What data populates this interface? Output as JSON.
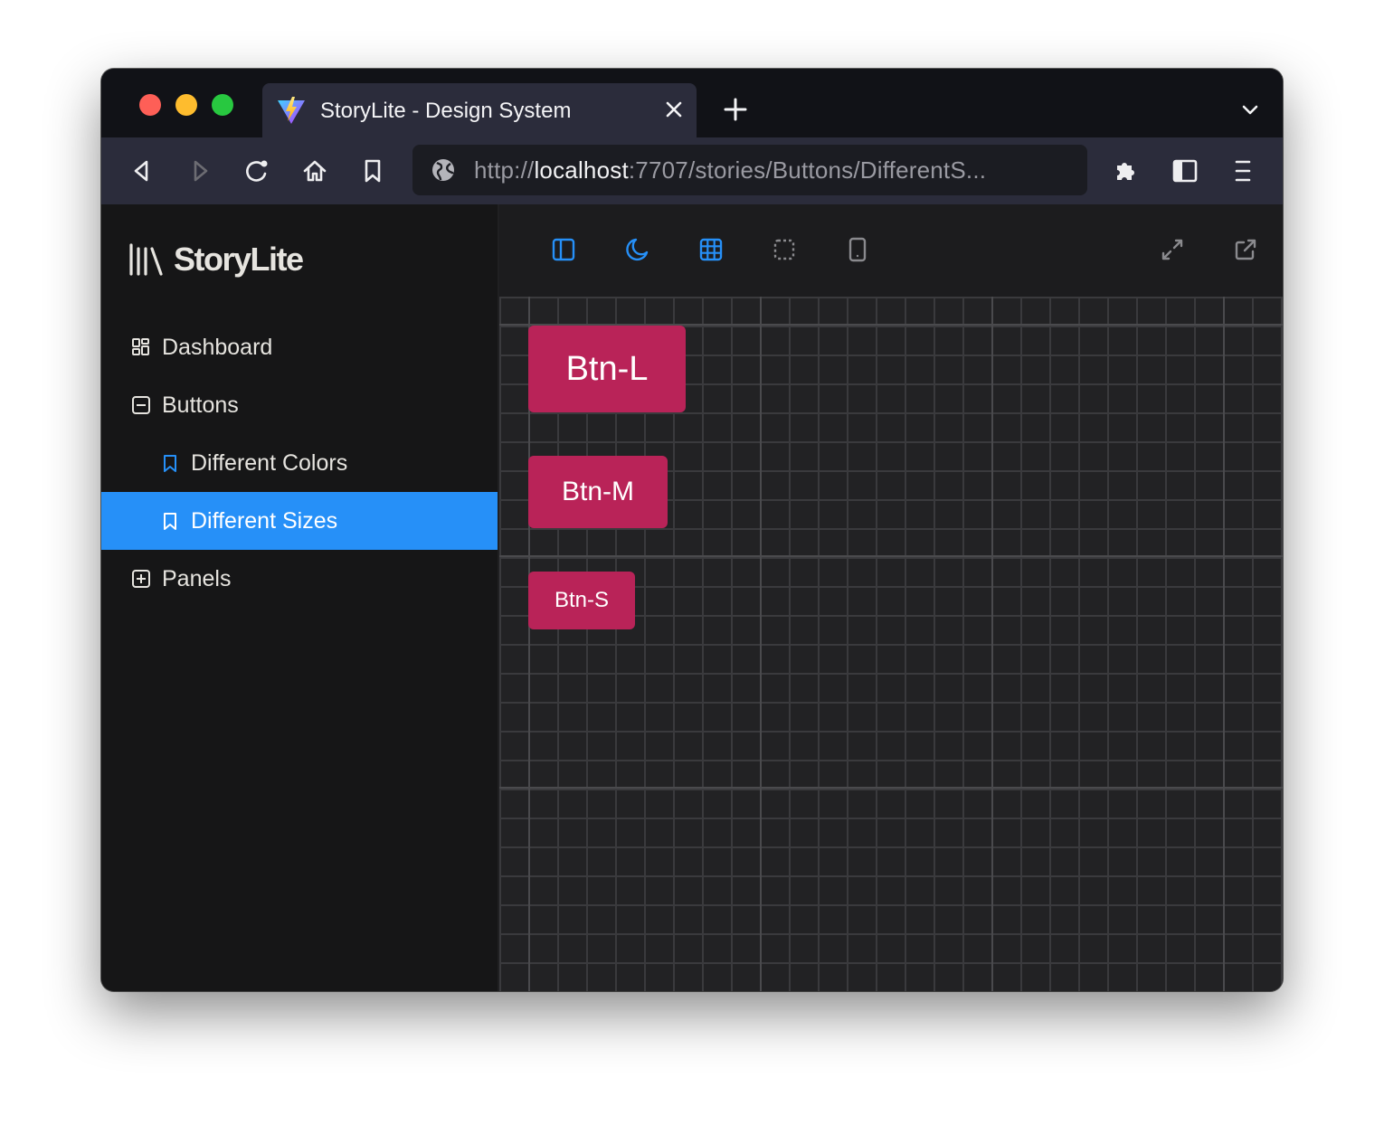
{
  "browser": {
    "tab": {
      "title": "StoryLite - Design System",
      "favicon": "vite-logo-icon"
    },
    "url": {
      "scheme": "http://",
      "host": "localhost",
      "rest": ":7707/stories/Buttons/DifferentS..."
    },
    "nav_icons": [
      "back-icon",
      "forward-icon",
      "reload-icon",
      "home-icon",
      "bookmark-icon"
    ],
    "right_icons": [
      "extensions-icon",
      "sidebar-toggle-icon",
      "menu-icon"
    ]
  },
  "app": {
    "logo_text": "StoryLite",
    "sidebar": {
      "items": [
        {
          "label": "Dashboard",
          "icon": "dashboard-icon",
          "level": 0,
          "active": false
        },
        {
          "label": "Buttons",
          "icon": "collapse-icon",
          "level": 0,
          "active": false,
          "expanded": true
        },
        {
          "label": "Different Colors",
          "icon": "bookmark-icon",
          "level": 1,
          "active": false
        },
        {
          "label": "Different Sizes",
          "icon": "bookmark-icon",
          "level": 1,
          "active": true
        },
        {
          "label": "Panels",
          "icon": "expand-icon",
          "level": 0,
          "active": false,
          "expanded": false
        }
      ]
    },
    "toolbar": {
      "tools": [
        {
          "name": "sidebar-toggle",
          "active": true
        },
        {
          "name": "dark-mode",
          "active": true
        },
        {
          "name": "grid",
          "active": true
        },
        {
          "name": "outline",
          "active": false
        },
        {
          "name": "mobile-viewport",
          "active": false
        }
      ],
      "right_tools": [
        "fullscreen",
        "open-new-window"
      ]
    },
    "canvas": {
      "buttons": [
        {
          "label": "Btn-L",
          "size": "large"
        },
        {
          "label": "Btn-M",
          "size": "medium"
        },
        {
          "label": "Btn-S",
          "size": "small"
        }
      ]
    }
  },
  "colors": {
    "accent": "#2690f8",
    "button": "#b92358",
    "sidebar_bg": "#161617",
    "canvas_bg": "#222224",
    "chrome_bg": "#2b2c3b",
    "tabstrip_bg": "#111217"
  }
}
